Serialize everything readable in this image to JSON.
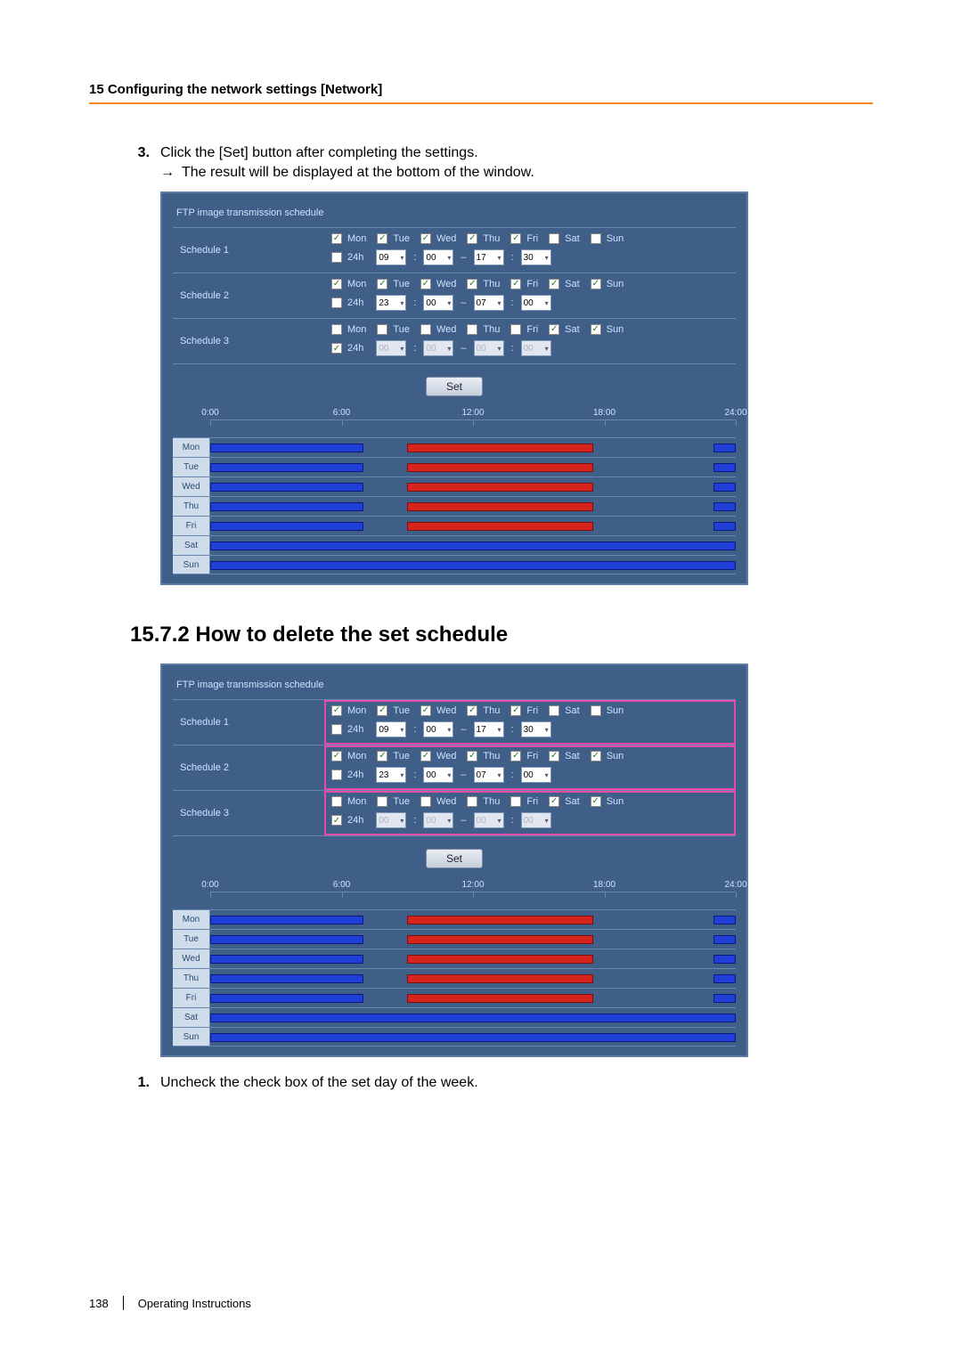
{
  "header": {
    "title": "15 Configuring the network settings [Network]"
  },
  "step3": {
    "num": "3.",
    "text": "Click the [Set] button after completing the settings.",
    "arrow": "→",
    "sub": "The result will be displayed at the bottom of the window."
  },
  "panel": {
    "title": "FTP image transmission schedule",
    "set_label": "Set",
    "days": [
      "Mon",
      "Tue",
      "Wed",
      "Thu",
      "Fri",
      "Sat",
      "Sun"
    ],
    "h24": "24h",
    "schedules": [
      {
        "label": "Schedule 1",
        "checks": [
          true,
          true,
          true,
          true,
          true,
          false,
          false
        ],
        "h24": false,
        "t": [
          "09",
          "00",
          "17",
          "30"
        ],
        "disabled": false
      },
      {
        "label": "Schedule 2",
        "checks": [
          true,
          true,
          true,
          true,
          true,
          true,
          true
        ],
        "h24": false,
        "t": [
          "23",
          "00",
          "07",
          "00"
        ],
        "disabled": false
      },
      {
        "label": "Schedule 3",
        "checks": [
          false,
          false,
          false,
          false,
          false,
          true,
          true
        ],
        "h24": true,
        "t": [
          "00",
          "00",
          "00",
          "00"
        ],
        "disabled": true
      }
    ],
    "axis": [
      "0:00",
      "6:00",
      "12:00",
      "18:00",
      "24:00"
    ],
    "timeline": {
      "Mon": [
        {
          "c": "c2",
          "s": 0,
          "e": 29.17
        },
        {
          "c": "c1",
          "s": 37.5,
          "e": 72.92
        },
        {
          "c": "c2",
          "s": 95.83,
          "e": 100
        }
      ],
      "Tue": [
        {
          "c": "c2",
          "s": 0,
          "e": 29.17
        },
        {
          "c": "c1",
          "s": 37.5,
          "e": 72.92
        },
        {
          "c": "c2",
          "s": 95.83,
          "e": 100
        }
      ],
      "Wed": [
        {
          "c": "c2",
          "s": 0,
          "e": 29.17
        },
        {
          "c": "c1",
          "s": 37.5,
          "e": 72.92
        },
        {
          "c": "c2",
          "s": 95.83,
          "e": 100
        }
      ],
      "Thu": [
        {
          "c": "c2",
          "s": 0,
          "e": 29.17
        },
        {
          "c": "c1",
          "s": 37.5,
          "e": 72.92
        },
        {
          "c": "c2",
          "s": 95.83,
          "e": 100
        }
      ],
      "Fri": [
        {
          "c": "c2",
          "s": 0,
          "e": 29.17
        },
        {
          "c": "c1",
          "s": 37.5,
          "e": 72.92
        },
        {
          "c": "c2",
          "s": 95.83,
          "e": 100
        }
      ],
      "Sat": [
        {
          "c": "c2",
          "s": 0,
          "e": 100
        }
      ],
      "Sun": [
        {
          "c": "c2",
          "s": 0,
          "e": 100
        }
      ]
    }
  },
  "section2": {
    "title": "15.7.2  How to delete the set schedule"
  },
  "step1": {
    "num": "1.",
    "text": "Uncheck the check box of the set day of the week."
  },
  "footer": {
    "page": "138",
    "label": "Operating Instructions"
  }
}
